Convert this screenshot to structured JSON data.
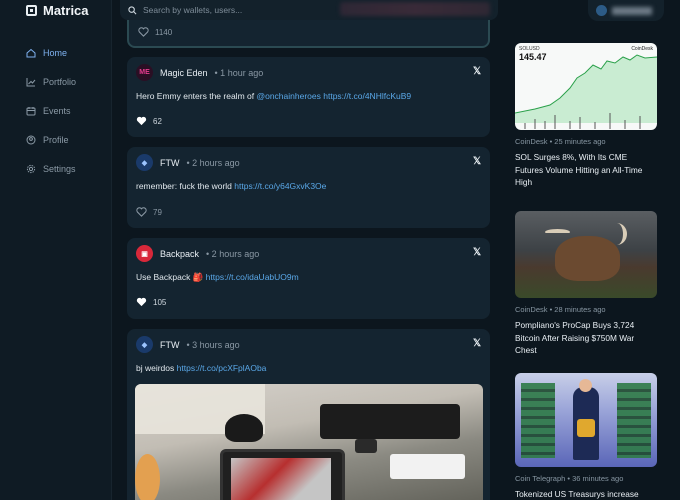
{
  "app": {
    "name": "Matrica"
  },
  "sidebar": {
    "items": [
      {
        "label": "Home",
        "icon": "home-icon",
        "active": true
      },
      {
        "label": "Portfolio",
        "icon": "chart-icon",
        "active": false
      },
      {
        "label": "Events",
        "icon": "calendar-icon",
        "active": false
      },
      {
        "label": "Profile",
        "icon": "user-icon",
        "active": false
      },
      {
        "label": "Settings",
        "icon": "gear-icon",
        "active": false
      }
    ]
  },
  "search": {
    "placeholder": "Search by wallets, users..."
  },
  "feed": {
    "top_card": {
      "likes": "1140"
    },
    "posts": [
      {
        "author": "Magic Eden",
        "time": "• 1 hour ago",
        "text": "Hero Emmy enters the realm of ",
        "mention": "@onchainheroes",
        "link": "https://t.co/4NHlfcKuB9",
        "likes": "62"
      },
      {
        "author": "FTW",
        "time": "• 2 hours ago",
        "text": "remember: fuck the world ",
        "link": "https://t.co/y64GxvK3Oe",
        "likes": "79"
      },
      {
        "author": "Backpack",
        "time": "• 2 hours ago",
        "text": "Use Backpack 🎒 ",
        "link": "https://t.co/idaUabUO9m",
        "likes": "105"
      },
      {
        "author": "FTW",
        "time": "• 3 hours ago",
        "text": "bj weirdos ",
        "link": "https://t.co/pcXFplAOba"
      }
    ]
  },
  "news": [
    {
      "source": "CoinDesk • 25 minutes ago",
      "title": "SOL Surges 8%, With Its CME Futures Volume Hitting an All-Time High",
      "img_label": "SOLUSD",
      "img_price": "145.47",
      "img_brand": "CoinDesk"
    },
    {
      "source": "CoinDesk • 28 minutes ago",
      "title": "Pompliano's ProCap Buys 3,724 Bitcoin After Raising $750M War Chest"
    },
    {
      "source": "Coin Telegraph • 36 minutes ago",
      "title": "Tokenized US Treasurys increase"
    }
  ],
  "colors": {
    "accent": "#7fb2f0",
    "link": "#5aa8e8",
    "background": "#0c161e",
    "card": "#142430"
  }
}
